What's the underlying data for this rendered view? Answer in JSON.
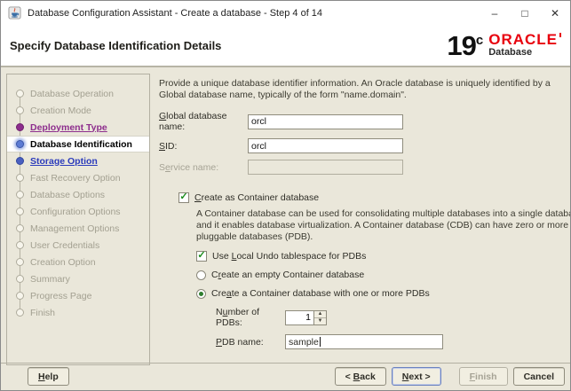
{
  "window": {
    "title": "Database Configuration Assistant - Create a database - Step 4 of 14",
    "controls": {
      "minimize": "–",
      "maximize": "□",
      "close": "✕"
    }
  },
  "header": {
    "title": "Specify Database Identification Details",
    "logo": {
      "version": "19",
      "suffix": "c",
      "brand": "ORACLE",
      "product": "Database"
    }
  },
  "colors": {
    "window_bg": "#eae7da",
    "oracle_red": "#e8000d",
    "visited_purple": "#8d2d8d",
    "link_blue": "#2b3bbb",
    "check_green": "#1b8c1b"
  },
  "sidebar": {
    "steps": [
      {
        "label": "Database Operation",
        "state": "disabled"
      },
      {
        "label": "Creation Mode",
        "state": "disabled"
      },
      {
        "label": "Deployment Type",
        "state": "visited"
      },
      {
        "label": "Database Identification",
        "state": "current"
      },
      {
        "label": "Storage Option",
        "state": "link"
      },
      {
        "label": "Fast Recovery Option",
        "state": "disabled"
      },
      {
        "label": "Database Options",
        "state": "disabled"
      },
      {
        "label": "Configuration Options",
        "state": "disabled"
      },
      {
        "label": "Management Options",
        "state": "disabled"
      },
      {
        "label": "User Credentials",
        "state": "disabled"
      },
      {
        "label": "Creation Option",
        "state": "disabled"
      },
      {
        "label": "Summary",
        "state": "disabled"
      },
      {
        "label": "Progress Page",
        "state": "disabled"
      },
      {
        "label": "Finish",
        "state": "disabled"
      }
    ]
  },
  "content": {
    "description": "Provide a unique database identifier information. An Oracle database is uniquely identified by a Global database name, typically of the form \"name.domain\".",
    "fields": {
      "global_db_name": {
        "label": "Global database name:",
        "mnemonic": "G",
        "value": "orcl"
      },
      "sid": {
        "label": "SID:",
        "mnemonic": "S",
        "value": "orcl"
      },
      "service_name": {
        "label": "Service name:",
        "mnemonic": "e",
        "value": ""
      }
    },
    "container": {
      "checkbox_label": "Create as Container database",
      "checkbox_mnemonic": "C",
      "checked": true,
      "description": "A Container database can be used for consolidating multiple databases into a single database, and it enables database virtualization. A Container database (CDB) can have zero or more pluggable databases (PDB).",
      "local_undo": {
        "label": "Use Local Undo tablespace for PDBs",
        "mnemonic": "L",
        "checked": true
      },
      "radio_empty": {
        "label": "Create an empty Container database",
        "mnemonic": "r",
        "selected": false
      },
      "radio_pdbs": {
        "label": "Create a Container database with one or more PDBs",
        "mnemonic": "a",
        "selected": true
      },
      "num_pdbs": {
        "label": "Number of PDBs:",
        "mnemonic": "u",
        "value": "1"
      },
      "pdb_name": {
        "label": "PDB name:",
        "mnemonic": "P",
        "value": "sample"
      }
    }
  },
  "footer": {
    "help": "Help",
    "help_mnemonic": "H",
    "back": "< Back",
    "back_mnemonic": "B",
    "next": "Next >",
    "next_mnemonic": "N",
    "finish": "Finish",
    "finish_mnemonic": "F",
    "cancel": "Cancel"
  }
}
